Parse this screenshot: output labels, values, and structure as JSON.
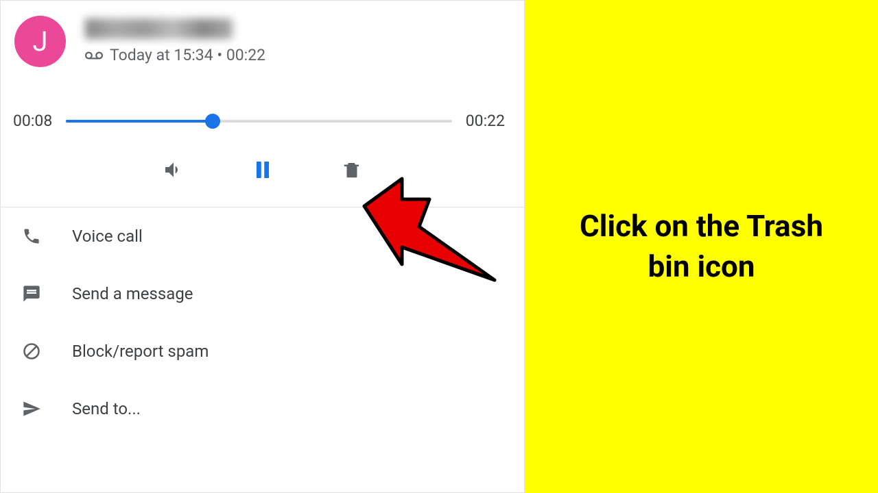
{
  "header": {
    "avatar_letter": "J",
    "timestamp_line": "Today at 15:34 • 00:22"
  },
  "player": {
    "current_time": "00:08",
    "total_time": "00:22",
    "progress_percent": 38
  },
  "menu": {
    "voice_call": "Voice call",
    "send_message": "Send a message",
    "block_report": "Block/report spam",
    "send_to": "Send to..."
  },
  "instruction": "Click on the Trash bin icon"
}
